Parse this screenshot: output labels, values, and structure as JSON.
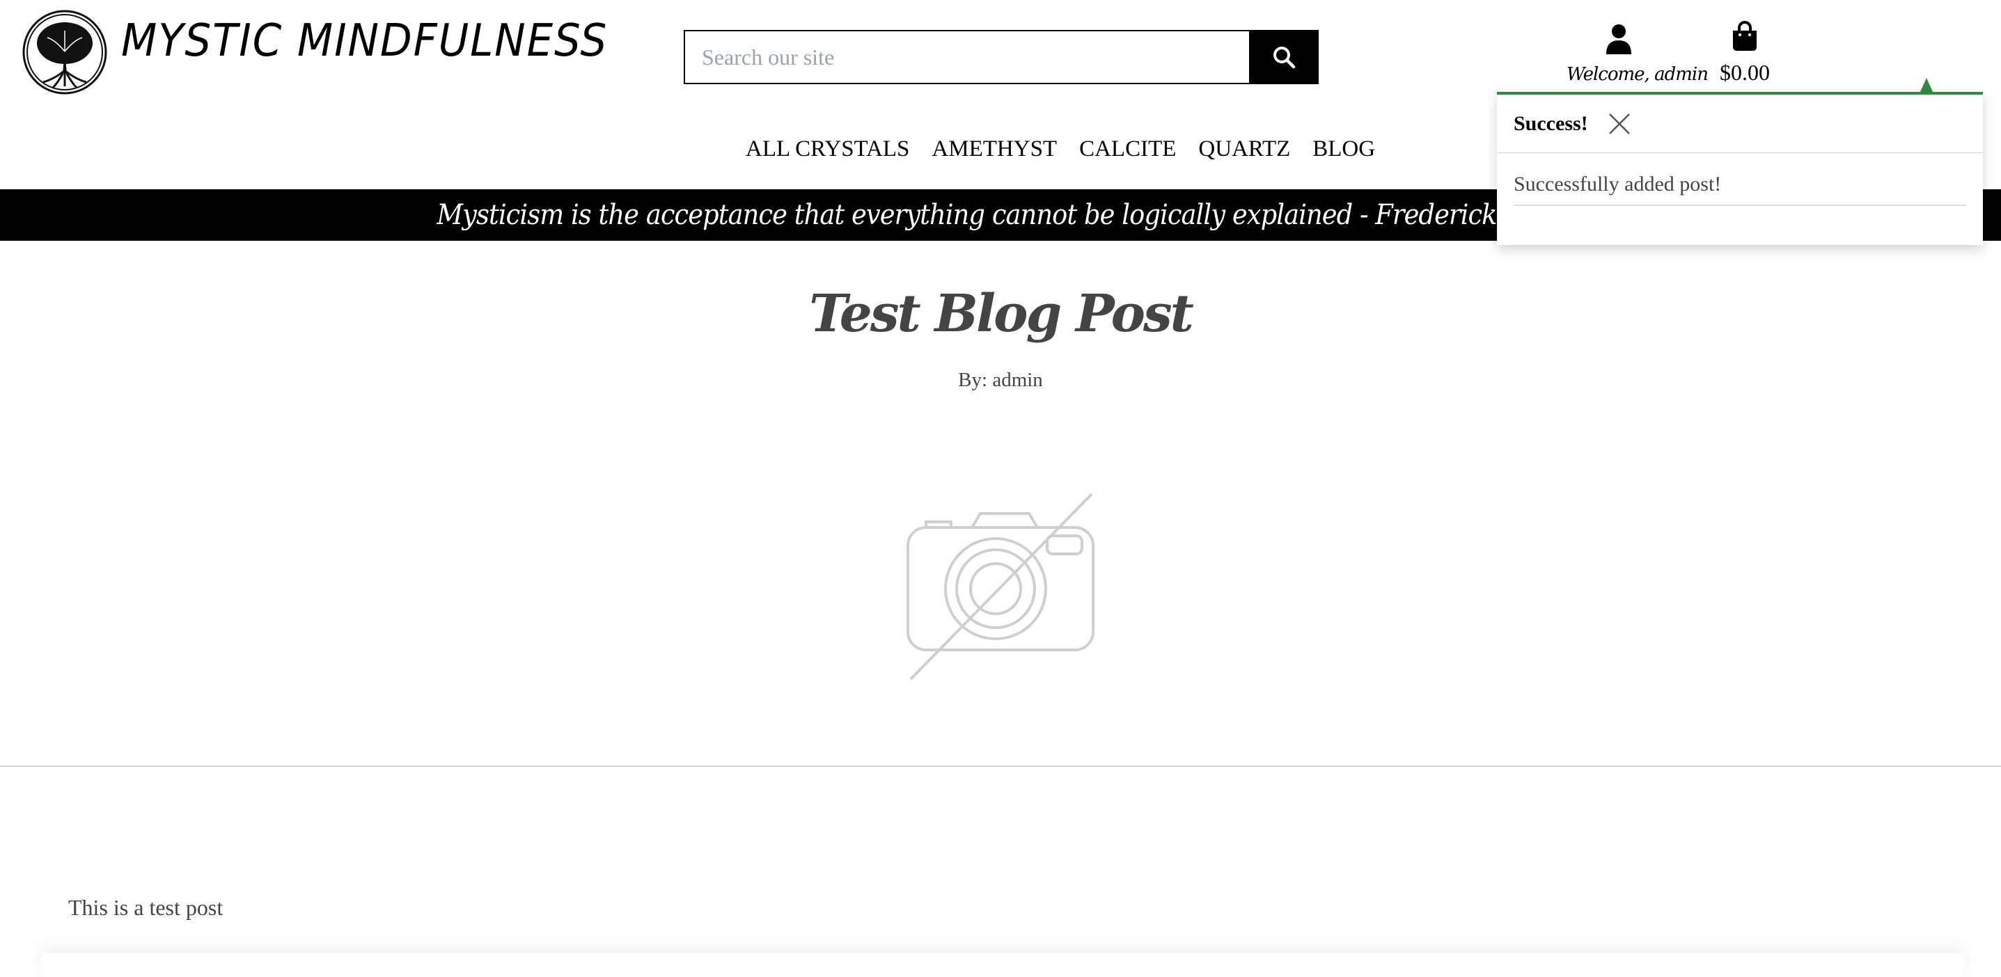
{
  "brand": {
    "name": "MYSTIC MINDFULNESS",
    "logo_icon": "tree-of-life-icon"
  },
  "search": {
    "placeholder": "Search our site",
    "icon": "search-icon"
  },
  "account": {
    "welcome": "Welcome, admin",
    "icon": "user-icon"
  },
  "bag": {
    "total": "$0.00",
    "icon": "shopping-bag-icon"
  },
  "nav": {
    "items": [
      "ALL CRYSTALS",
      "AMETHYST",
      "CALCITE",
      "QUARTZ",
      "BLOG"
    ]
  },
  "banner": {
    "quote": "Mysticism is the acceptance that everything cannot be logically explained - Frederick Lenz"
  },
  "post": {
    "title": "Test Blog Post",
    "author": "By: admin",
    "image_icon": "no-image-camera-icon",
    "body": "This is a test post"
  },
  "toast": {
    "title": "Success!",
    "message": "Successfully added post!",
    "accent_color": "#2e8b3e"
  }
}
